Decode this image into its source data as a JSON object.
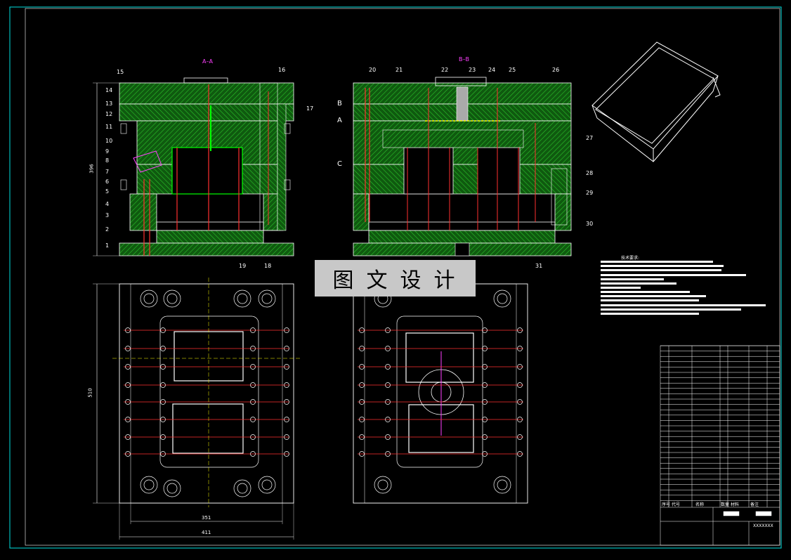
{
  "sections": {
    "aa": "A–A",
    "bb": "B–B"
  },
  "banner": "图文设计",
  "left_part_numbers": [
    "15",
    "14",
    "13",
    "12",
    "11",
    "10",
    "9",
    "8",
    "7",
    "6",
    "5",
    "4",
    "3",
    "2",
    "1"
  ],
  "left_bottom_numbers": [
    "19",
    "18"
  ],
  "left_right_numbers": [
    "16",
    "17"
  ],
  "right_top_numbers": [
    "20",
    "21",
    "22",
    "23",
    "24",
    "25",
    "26"
  ],
  "right_side_numbers": [
    "27",
    "28",
    "29",
    "30",
    "31"
  ],
  "right_letters": [
    "B",
    "A",
    "C"
  ],
  "dimensions": {
    "height_left": "396",
    "height_plan": "510",
    "width_inner": "351",
    "width_outer": "411"
  },
  "tech_title": "技术要求:",
  "title_block": {
    "drawing_no": "XXXXXXX",
    "header_cells": [
      "序号",
      "代号",
      "名称",
      "数量",
      "材料",
      "备注"
    ]
  },
  "colors": {
    "frame": "#00e0e0",
    "line": "#ffffff",
    "hatch": "#1a8f1a",
    "red": "#ff3030",
    "magenta": "#ff40ff",
    "cyan": "#00ffff",
    "yellow": "#ffff00",
    "blue": "#4070ff"
  }
}
